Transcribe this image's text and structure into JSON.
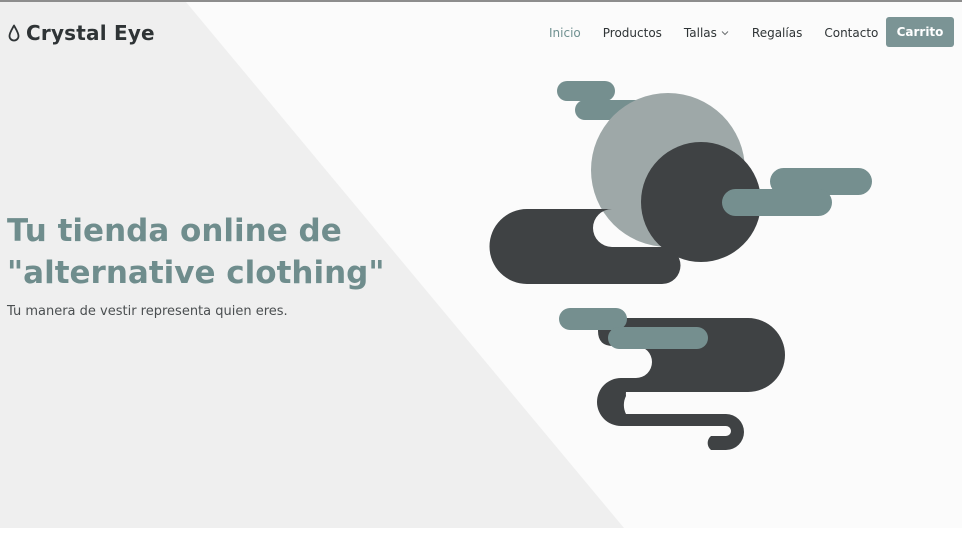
{
  "brand": {
    "name": "Crystal Eye",
    "icon": "drop-icon"
  },
  "nav": {
    "items": [
      {
        "label": "Inicio",
        "active": true
      },
      {
        "label": "Productos"
      },
      {
        "label": "Tallas",
        "has_dropdown": true
      },
      {
        "label": "Regalías"
      },
      {
        "label": "Contacto"
      }
    ],
    "cart_label": "Carrito"
  },
  "hero": {
    "title_line1": "Tu tienda online de",
    "title_line2": "\"alternative clothing\"",
    "subtitle": "Tu manera de vestir representa quien eres."
  },
  "colors": {
    "accent": "#6f8d8d",
    "button": "#7b9495",
    "dark_shape": "#3f4244",
    "light_circle": "#9ea8a8",
    "teal_shape": "#758f8f",
    "diagonal_panel": "#efefef"
  }
}
